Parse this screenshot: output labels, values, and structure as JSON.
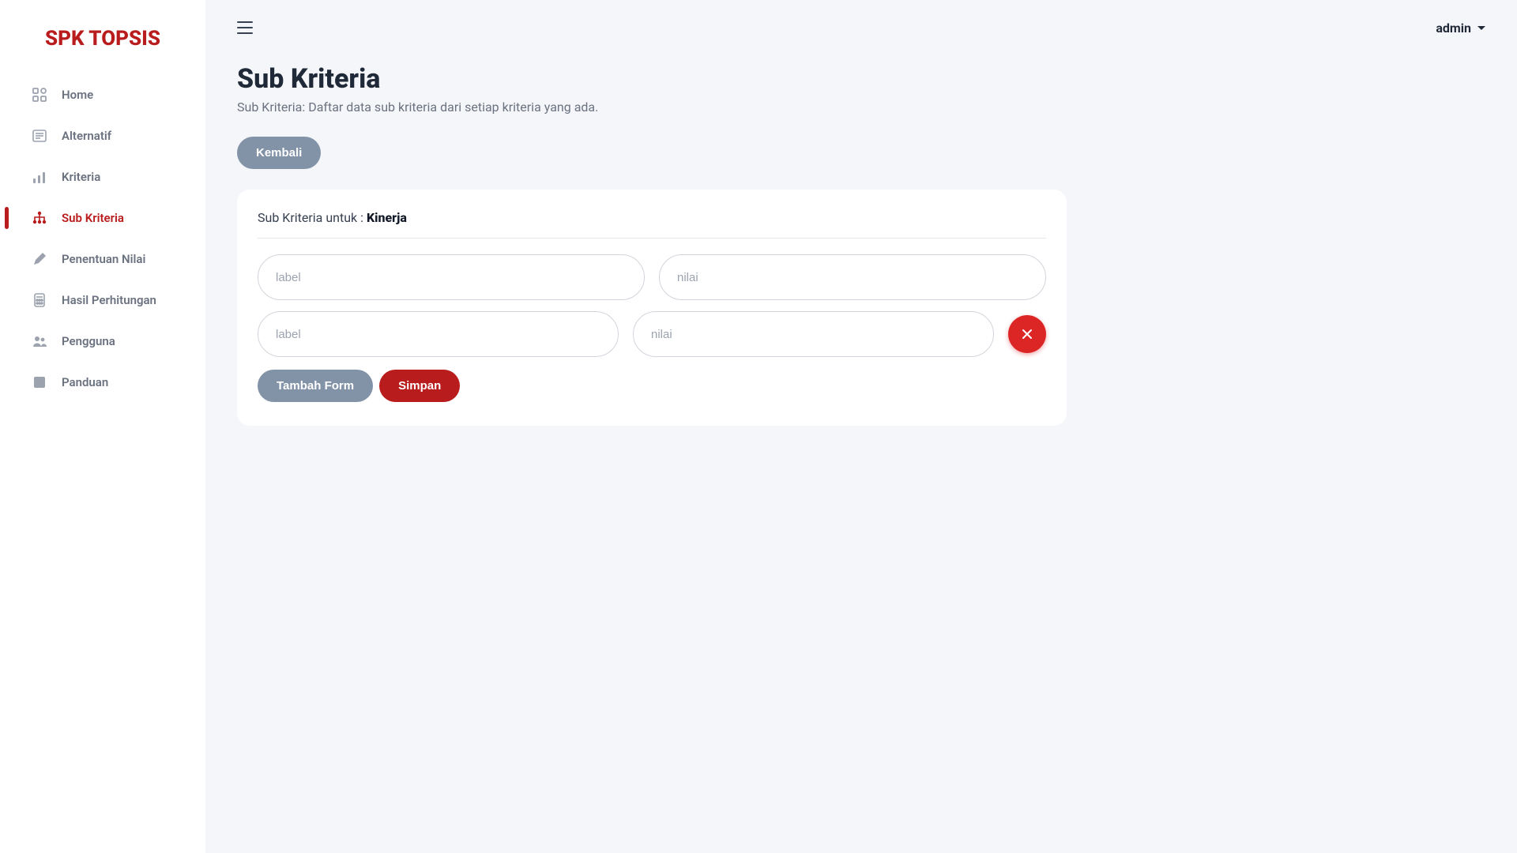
{
  "brand": "SPK TOPSIS",
  "sidebar": {
    "items": [
      {
        "label": "Home",
        "icon": "grid-icon",
        "active": false
      },
      {
        "label": "Alternatif",
        "icon": "list-icon",
        "active": false
      },
      {
        "label": "Kriteria",
        "icon": "bar-chart-icon",
        "active": false
      },
      {
        "label": "Sub Kriteria",
        "icon": "hierarchy-icon",
        "active": true
      },
      {
        "label": "Penentuan Nilai",
        "icon": "pen-icon",
        "active": false
      },
      {
        "label": "Hasil Perhitungan",
        "icon": "calculator-icon",
        "active": false
      },
      {
        "label": "Pengguna",
        "icon": "users-icon",
        "active": false
      },
      {
        "label": "Panduan",
        "icon": "help-square-icon",
        "active": false
      }
    ]
  },
  "header": {
    "username": "admin"
  },
  "page": {
    "title": "Sub Kriteria",
    "subtitle": "Sub Kriteria: Daftar data sub kriteria dari setiap kriteria yang ada.",
    "back_label": "Kembali"
  },
  "card": {
    "prefix": "Sub Kriteria untuk : ",
    "criteria_name": "Kinerja",
    "label_placeholder": "label",
    "nilai_placeholder": "nilai",
    "rows": [
      {
        "label_value": "",
        "nilai_value": "",
        "removable": false
      },
      {
        "label_value": "",
        "nilai_value": "",
        "removable": true
      }
    ],
    "add_form_label": "Tambah Form",
    "save_label": "Simpan"
  }
}
